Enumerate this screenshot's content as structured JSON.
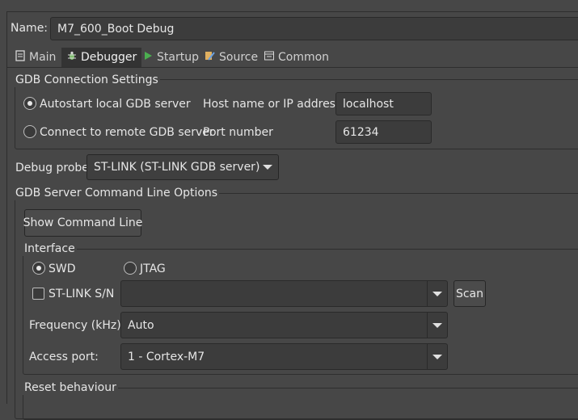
{
  "name": {
    "label": "Name:",
    "value": "M7_600_Boot Debug"
  },
  "tabs": [
    {
      "label": "Main",
      "icon": "main-tab-icon",
      "active": false
    },
    {
      "label": "Debugger",
      "icon": "debugger-bug-icon",
      "active": true
    },
    {
      "label": "Startup",
      "icon": "startup-play-icon",
      "active": false
    },
    {
      "label": "Source",
      "icon": "source-icon",
      "active": false
    },
    {
      "label": "Common",
      "icon": "common-icon",
      "active": false
    }
  ],
  "gdb_connection": {
    "title": "GDB Connection Settings",
    "autostart_label": "Autostart local GDB server",
    "autostart_selected": true,
    "remote_label": "Connect to remote GDB server",
    "remote_selected": false,
    "host_label": "Host name or IP address",
    "host_value": "localhost",
    "port_label": "Port number",
    "port_value": "61234"
  },
  "debug_probe": {
    "label": "Debug probe",
    "value": "ST-LINK (ST-LINK GDB server)"
  },
  "server_options": {
    "title": "GDB Server Command Line Options",
    "show_cmd_button": "Show Command Line"
  },
  "interface": {
    "title": "Interface",
    "swd_label": "SWD",
    "swd_selected": true,
    "jtag_label": "JTAG",
    "jtag_selected": false,
    "stlink_sn_label": "ST-LINK S/N",
    "stlink_sn_checked": false,
    "stlink_sn_value": "",
    "scan_button": "Scan",
    "frequency_label": "Frequency (kHz):",
    "frequency_value": "Auto",
    "access_port_label": "Access port:",
    "access_port_value": "1 - Cortex-M7"
  },
  "reset": {
    "title": "Reset behaviour"
  },
  "colors": {
    "background": "#474747",
    "field": "#3c3c3c",
    "text": "#e6e6e6",
    "startup_icon": "#4caf50"
  }
}
